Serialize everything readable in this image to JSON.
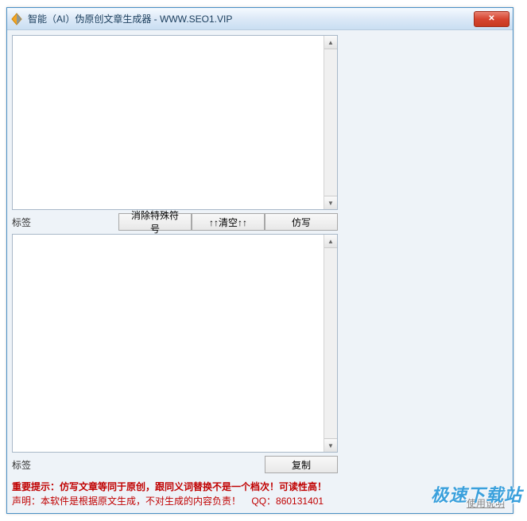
{
  "window": {
    "title": "智能（AI）伪原创文章生成器 - WWW.SEO1.VIP"
  },
  "top": {
    "label": "标签",
    "buttons": {
      "del_special": "消除特殊符号",
      "clear": "↑↑清空↑↑",
      "rewrite": "仿写"
    },
    "value": ""
  },
  "bottom": {
    "label": "标签",
    "buttons": {
      "copy": "复制"
    },
    "value": ""
  },
  "notice": {
    "line1": "重要提示：仿写文章等同于原创，跟同义词替换不是一个档次！可读性高！",
    "line2_a": "声明：本软件是根据原文生成，不对生成的内容负责！",
    "line2_b": "QQ：860131401"
  },
  "footer": {
    "link": "使用说明"
  },
  "watermark": "极速下载站"
}
